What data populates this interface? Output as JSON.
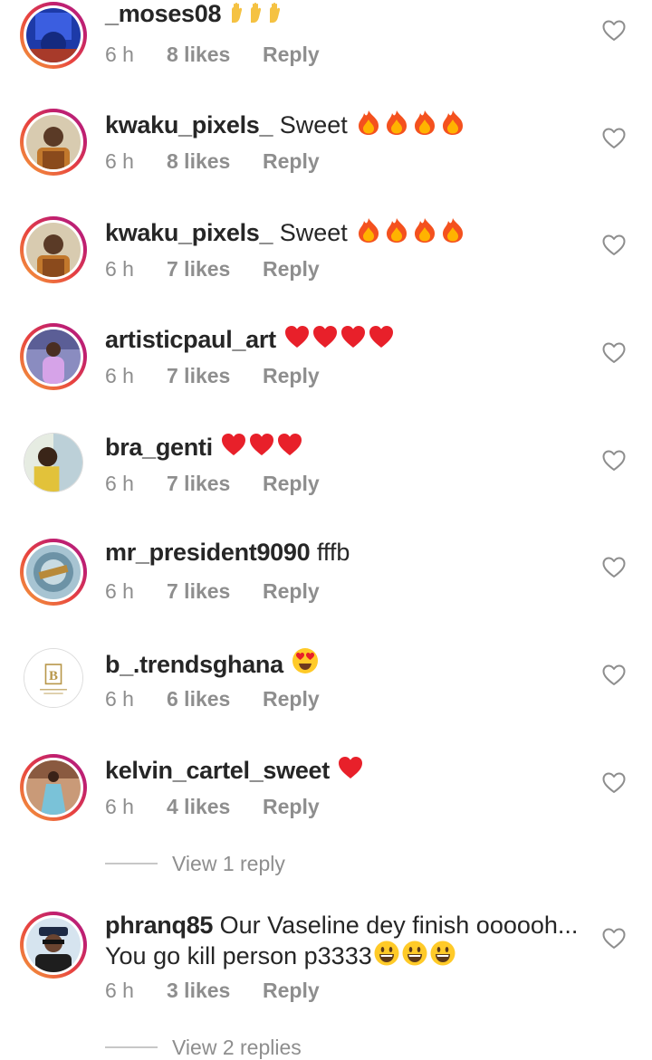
{
  "comments": [
    {
      "username": "_moses08",
      "text": "",
      "emojis": [
        "hands",
        "hands",
        "hands"
      ],
      "time": "6 h",
      "likes": "8 likes",
      "reply": "Reply",
      "avatar_style": "ring",
      "avatar_bg": "#1d3aa8"
    },
    {
      "username": "kwaku_pixels_",
      "text": "Sweet",
      "emojis": [
        "fire",
        "fire",
        "fire",
        "fire"
      ],
      "time": "6 h",
      "likes": "8 likes",
      "reply": "Reply",
      "avatar_style": "ring",
      "avatar_bg": "#c9b89a"
    },
    {
      "username": "kwaku_pixels_",
      "text": "Sweet",
      "emojis": [
        "fire",
        "fire",
        "fire",
        "fire"
      ],
      "time": "6 h",
      "likes": "7 likes",
      "reply": "Reply",
      "avatar_style": "ring",
      "avatar_bg": "#c9b89a"
    },
    {
      "username": "artisticpaul_art",
      "text": "",
      "emojis": [
        "heart",
        "heart",
        "heart",
        "heart"
      ],
      "time": "6 h",
      "likes": "7 likes",
      "reply": "Reply",
      "avatar_style": "ring",
      "avatar_bg": "#7d7fb5"
    },
    {
      "username": "bra_genti",
      "text": "",
      "emojis": [
        "heart",
        "heart",
        "heart"
      ],
      "time": "6 h",
      "likes": "7 likes",
      "reply": "Reply",
      "avatar_style": "plain",
      "avatar_bg": "#dfe6dc"
    },
    {
      "username": "mr_president9090",
      "text": "fffb",
      "emojis": [],
      "time": "6 h",
      "likes": "7 likes",
      "reply": "Reply",
      "avatar_style": "ring",
      "avatar_bg": "#8fb4c8"
    },
    {
      "username": "b_.trendsghana",
      "text": "",
      "emojis": [
        "heart-eyes"
      ],
      "time": "6 h",
      "likes": "6 likes",
      "reply": "Reply",
      "avatar_style": "plain",
      "avatar_bg": "#ffffff"
    },
    {
      "username": "kelvin_cartel_sweet",
      "text": "",
      "emojis": [
        "heart"
      ],
      "time": "6 h",
      "likes": "4 likes",
      "reply": "Reply",
      "avatar_style": "ring",
      "avatar_bg": "#b07a5e"
    },
    {
      "username": "phranq85",
      "text": "Our Vaseline dey finish oooooh...",
      "text_line2": "You go kill person p3333",
      "emojis": [
        "grin",
        "grin",
        "grin"
      ],
      "time": "6 h",
      "likes": "3 likes",
      "reply": "Reply",
      "avatar_style": "ring",
      "avatar_bg": "#bcd4ea"
    }
  ],
  "view_replies": [
    {
      "label": "View 1 reply"
    },
    {
      "label": "View 2 replies"
    }
  ],
  "colors": {
    "username": "#262626",
    "meta": "#8e8e8e",
    "heart_outline": "#8e8e8e",
    "ring_start": "#f4a23b",
    "ring_end": "#b6257f"
  },
  "icons": {
    "like": "heart-outline-icon",
    "fire": "fire-emoji",
    "heart": "red-heart-emoji",
    "hands": "raised-hands-emoji",
    "heart-eyes": "heart-eyes-emoji",
    "grin": "grinning-face-emoji"
  }
}
